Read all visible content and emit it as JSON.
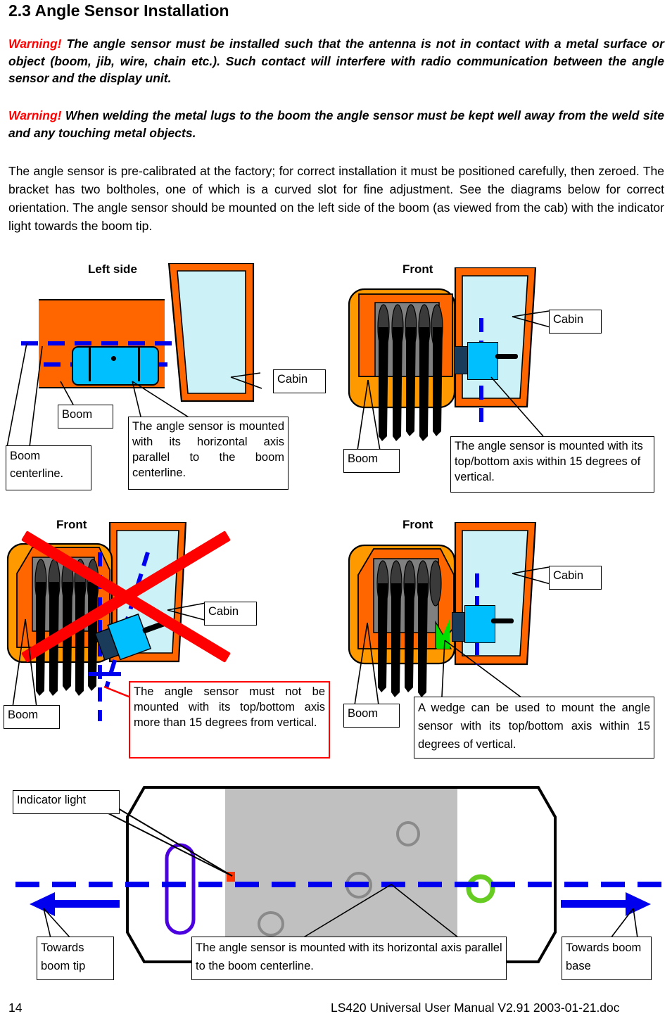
{
  "document": {
    "section_number": "2.3",
    "section_title": "2.3 Angle Sensor Installation",
    "warning_label": "Warning!",
    "warning1_text": " The angle sensor must be installed such that the antenna is not in contact with a metal surface or object (boom, jib, wire, chain etc.). Such contact will interfere with radio communication between the angle sensor and the display unit.",
    "warning2_text": " When welding the metal lugs to the boom the angle sensor must be kept well away from the weld site and any touching metal objects.",
    "body_paragraph": "The angle sensor is pre-calibrated at the factory; for correct installation it must be positioned carefully, then zeroed. The bracket has two boltholes, one of which is a curved slot for fine adjustment.   See the diagrams below for correct orientation. The angle sensor should be mounted on the left side of the boom (as viewed from the cab) with the indicator light towards the boom tip.",
    "footer_page": "14",
    "footer_doc": "LS420 Universal User Manual V2.91 2003-01-21.doc"
  },
  "diagram1": {
    "view_label": "Left side",
    "cabin_label": "Cabin",
    "boom_label": "Boom",
    "boom_centerline_label": "Boom centerline.",
    "note": "The angle sensor is mounted with its horizontal axis parallel to the boom centerline."
  },
  "diagram2": {
    "view_label": "Front",
    "cabin_label": "Cabin",
    "boom_label": "Boom",
    "note": "The angle sensor is mounted with its top/bottom axis within 15 degrees of vertical."
  },
  "diagram3": {
    "view_label": "Front",
    "cabin_label": "Cabin",
    "boom_label": "Boom",
    "note": "The angle sensor must not be mounted with its top/bottom axis more than 15 degrees from vertical.",
    "marked_invalid": "red-cross-overlay"
  },
  "diagram4": {
    "view_label": "Front",
    "cabin_label": "Cabin",
    "boom_label": "Boom",
    "note": "A wedge can be used to mount the angle sensor with its top/bottom axis within 15 degrees of vertical."
  },
  "diagram5": {
    "indicator_light_label": "Indicator light",
    "towards_boom_tip_label": "Towards boom tip",
    "towards_boom_base_label": "Towards boom base",
    "note": "The angle sensor is mounted with its horizontal axis parallel to the boom centerline."
  },
  "colors": {
    "warning_red": "#ff0000",
    "boom_orange": "#ff6600",
    "boom_orange_light": "#ff9900",
    "cabin_glass": "#ccf2f7",
    "sensor_cyan": "#00bfff",
    "sensor_cyan_dark": "#1a3c5a",
    "centerline_blue": "#0000ee",
    "wedge_green": "#00e000",
    "indicator_red": "#ff3300",
    "bolt_green": "#66cc22",
    "plate_gray": "#c0c0c0"
  }
}
